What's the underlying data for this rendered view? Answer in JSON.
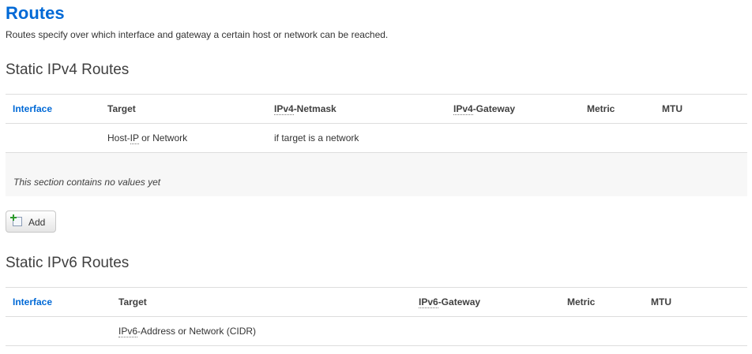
{
  "page": {
    "title": "Routes",
    "description": "Routes specify over which interface and gateway a certain host or network can be reached."
  },
  "ipv4": {
    "title": "Static IPv4 Routes",
    "headers": {
      "interface": "Interface",
      "target": "Target",
      "netmask_abbr": "IPv4",
      "netmask_rest": "-Netmask",
      "gateway_abbr": "IPv4",
      "gateway_rest": "-Gateway",
      "metric": "Metric",
      "mtu": "MTU"
    },
    "hints": {
      "target_pre": "Host-",
      "target_abbr": "IP",
      "target_post": " or Network",
      "netmask": "if target is a network"
    },
    "empty_text": "This section contains no values yet",
    "add_label": "Add"
  },
  "ipv6": {
    "title": "Static IPv6 Routes",
    "headers": {
      "interface": "Interface",
      "target": "Target",
      "gateway_abbr": "IPv6",
      "gateway_rest": "-Gateway",
      "metric": "Metric",
      "mtu": "MTU"
    },
    "hints": {
      "target_abbr": "IPv6",
      "target_post": "-Address or Network (CIDR)"
    }
  },
  "colors": {
    "accent": "#0069d6",
    "border": "#dddddd",
    "empty_bg": "#f7f7f7"
  },
  "icons": {
    "add": "document-add-icon"
  }
}
